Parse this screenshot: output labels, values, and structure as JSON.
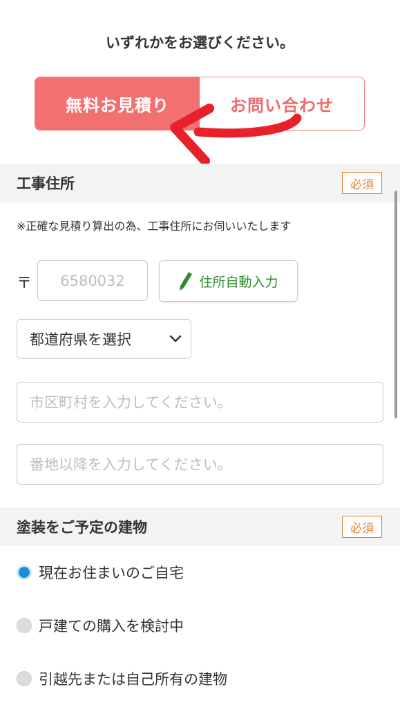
{
  "prompt": "いずれかをお選びください。",
  "toggle": {
    "active_label": "無料お見積り",
    "inactive_label": "お問い合わせ"
  },
  "section_address": {
    "title": "工事住所",
    "required_badge": "必須",
    "note": "※正確な見積り算出の為、工事住所にお伺いいたします",
    "zip_mark": "〒",
    "zip_placeholder": "6580032",
    "autofill_label": "住所自動入力",
    "prefecture_value": "都道府県を選択",
    "city_placeholder": "市区町村を入力してください。",
    "address_placeholder": "番地以降を入力してください。"
  },
  "section_building": {
    "title": "塗装をご予定の建物",
    "required_badge": "必須",
    "options": [
      {
        "label": "現在お住まいのご自宅",
        "checked": true
      },
      {
        "label": "戸建ての購入を検討中",
        "checked": false
      },
      {
        "label": "引越先または自己所有の建物",
        "checked": false
      }
    ]
  },
  "colors": {
    "accent": "#f27070",
    "badge": "#e27f2e",
    "autofill_green": "#2e8b2e",
    "radio_checked": "#1a8fe0",
    "annotation_arrow": "#e8202a"
  },
  "icons": {
    "autofill": "pencil-icon",
    "prefecture": "chevron-down-icon"
  }
}
